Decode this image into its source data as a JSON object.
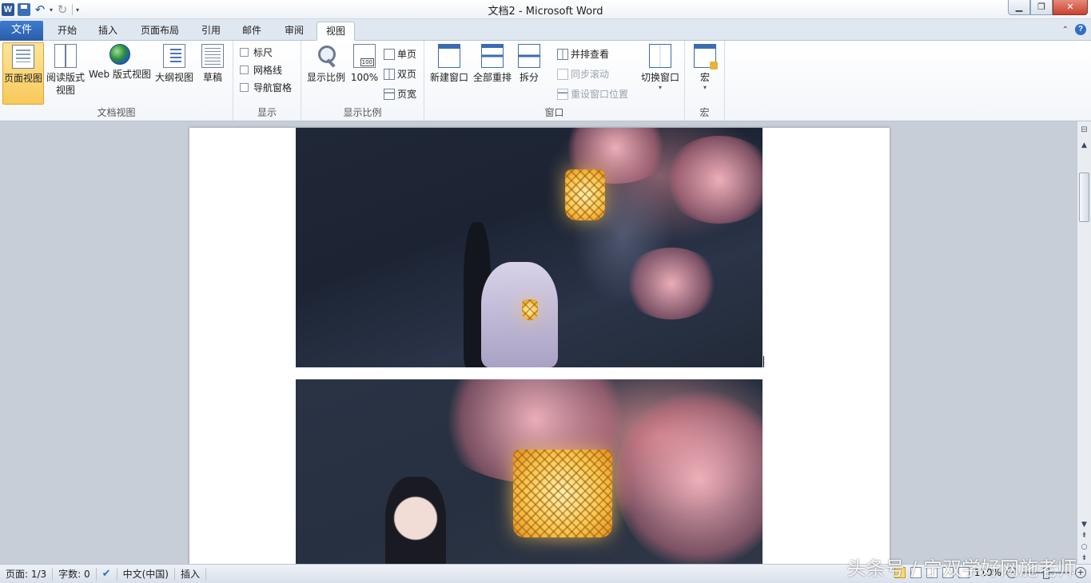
{
  "window": {
    "title": "文档2  -  Microsoft Word"
  },
  "quick_access": {
    "app_icon": "word-app-icon",
    "items": [
      "save-icon",
      "undo-icon",
      "redo-icon",
      "customize-dropdown-icon"
    ]
  },
  "tabs": {
    "file": "文件",
    "items": [
      "开始",
      "插入",
      "页面布局",
      "引用",
      "邮件",
      "审阅",
      "视图"
    ],
    "active": "视图"
  },
  "ribbon": {
    "document_views": {
      "label": "文档视图",
      "print_layout": "页面视图",
      "full_screen_reading_line1": "阅读版式",
      "full_screen_reading_line2": "视图",
      "web_layout": "Web 版式视图",
      "outline": "大纲视图",
      "draft": "草稿"
    },
    "show": {
      "label": "显示",
      "ruler": "标尺",
      "gridlines": "网格线",
      "navigation_pane": "导航窗格"
    },
    "zoom": {
      "label": "显示比例",
      "zoom": "显示比例",
      "percent_100": "100%",
      "one_page": "单页",
      "two_pages": "双页",
      "page_width": "页宽"
    },
    "window": {
      "label": "窗口",
      "new_window": "新建窗口",
      "arrange_all": "全部重排",
      "split": "拆分",
      "view_side_by_side": "并排查看",
      "sync_scrolling": "同步滚动",
      "reset_position": "重设窗口位置",
      "switch_windows": "切换窗口"
    },
    "macros": {
      "label": "宏",
      "macros": "宏"
    }
  },
  "statusbar": {
    "page": "页面: 1/3",
    "words": "字数: 0",
    "language": "中文(中国)",
    "mode": "插入",
    "zoom": "110%"
  },
  "watermark": "头条号 / 宁双学好网施老师"
}
